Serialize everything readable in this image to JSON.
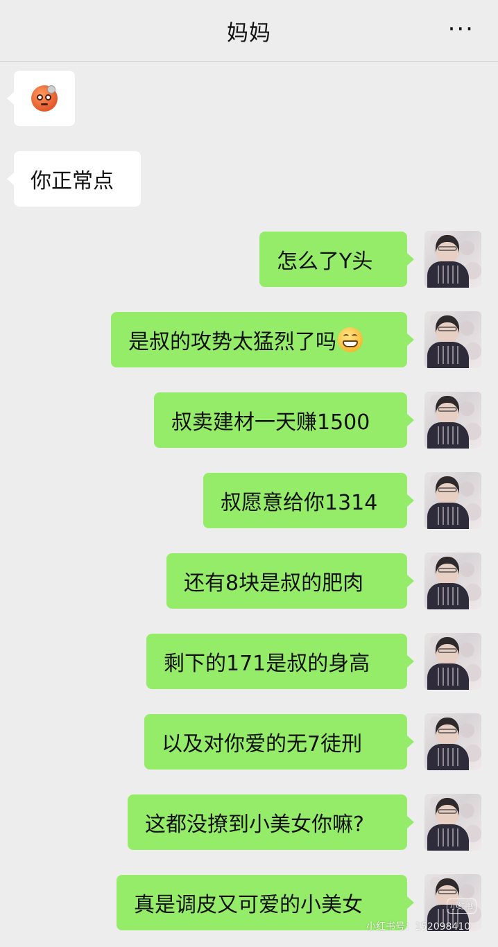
{
  "header": {
    "title": "妈妈",
    "more_icon": "more-icon",
    "more_label": "···"
  },
  "messages": [
    {
      "side": "left",
      "type": "emoji",
      "emoji": "angry-face-emoji"
    },
    {
      "side": "left",
      "type": "text",
      "text": "你正常点"
    },
    {
      "side": "right",
      "type": "text",
      "text": "怎么了Y头"
    },
    {
      "side": "right",
      "type": "text",
      "text": "是叔的攻势太猛烈了吗",
      "trailing_emoji": "grinning-face-emoji"
    },
    {
      "side": "right",
      "type": "text",
      "text": "叔卖建材一天赚1500"
    },
    {
      "side": "right",
      "type": "text",
      "text": "叔愿意给你1314"
    },
    {
      "side": "right",
      "type": "text",
      "text": "还有8块是叔的肥肉"
    },
    {
      "side": "right",
      "type": "text",
      "text": "剩下的171是叔的身高"
    },
    {
      "side": "right",
      "type": "text",
      "text": "以及对你爱的无7徒刑"
    },
    {
      "side": "right",
      "type": "text",
      "text": "这都没撩到小美女你嘛?"
    },
    {
      "side": "right",
      "type": "text",
      "text": "真是调皮又可爱的小美女"
    }
  ],
  "watermark": {
    "logo_text": "小红书",
    "id_text": "小红书号：152098410"
  },
  "colors": {
    "background": "#ededed",
    "outgoing_bubble": "#95ec69",
    "incoming_bubble": "#ffffff"
  }
}
